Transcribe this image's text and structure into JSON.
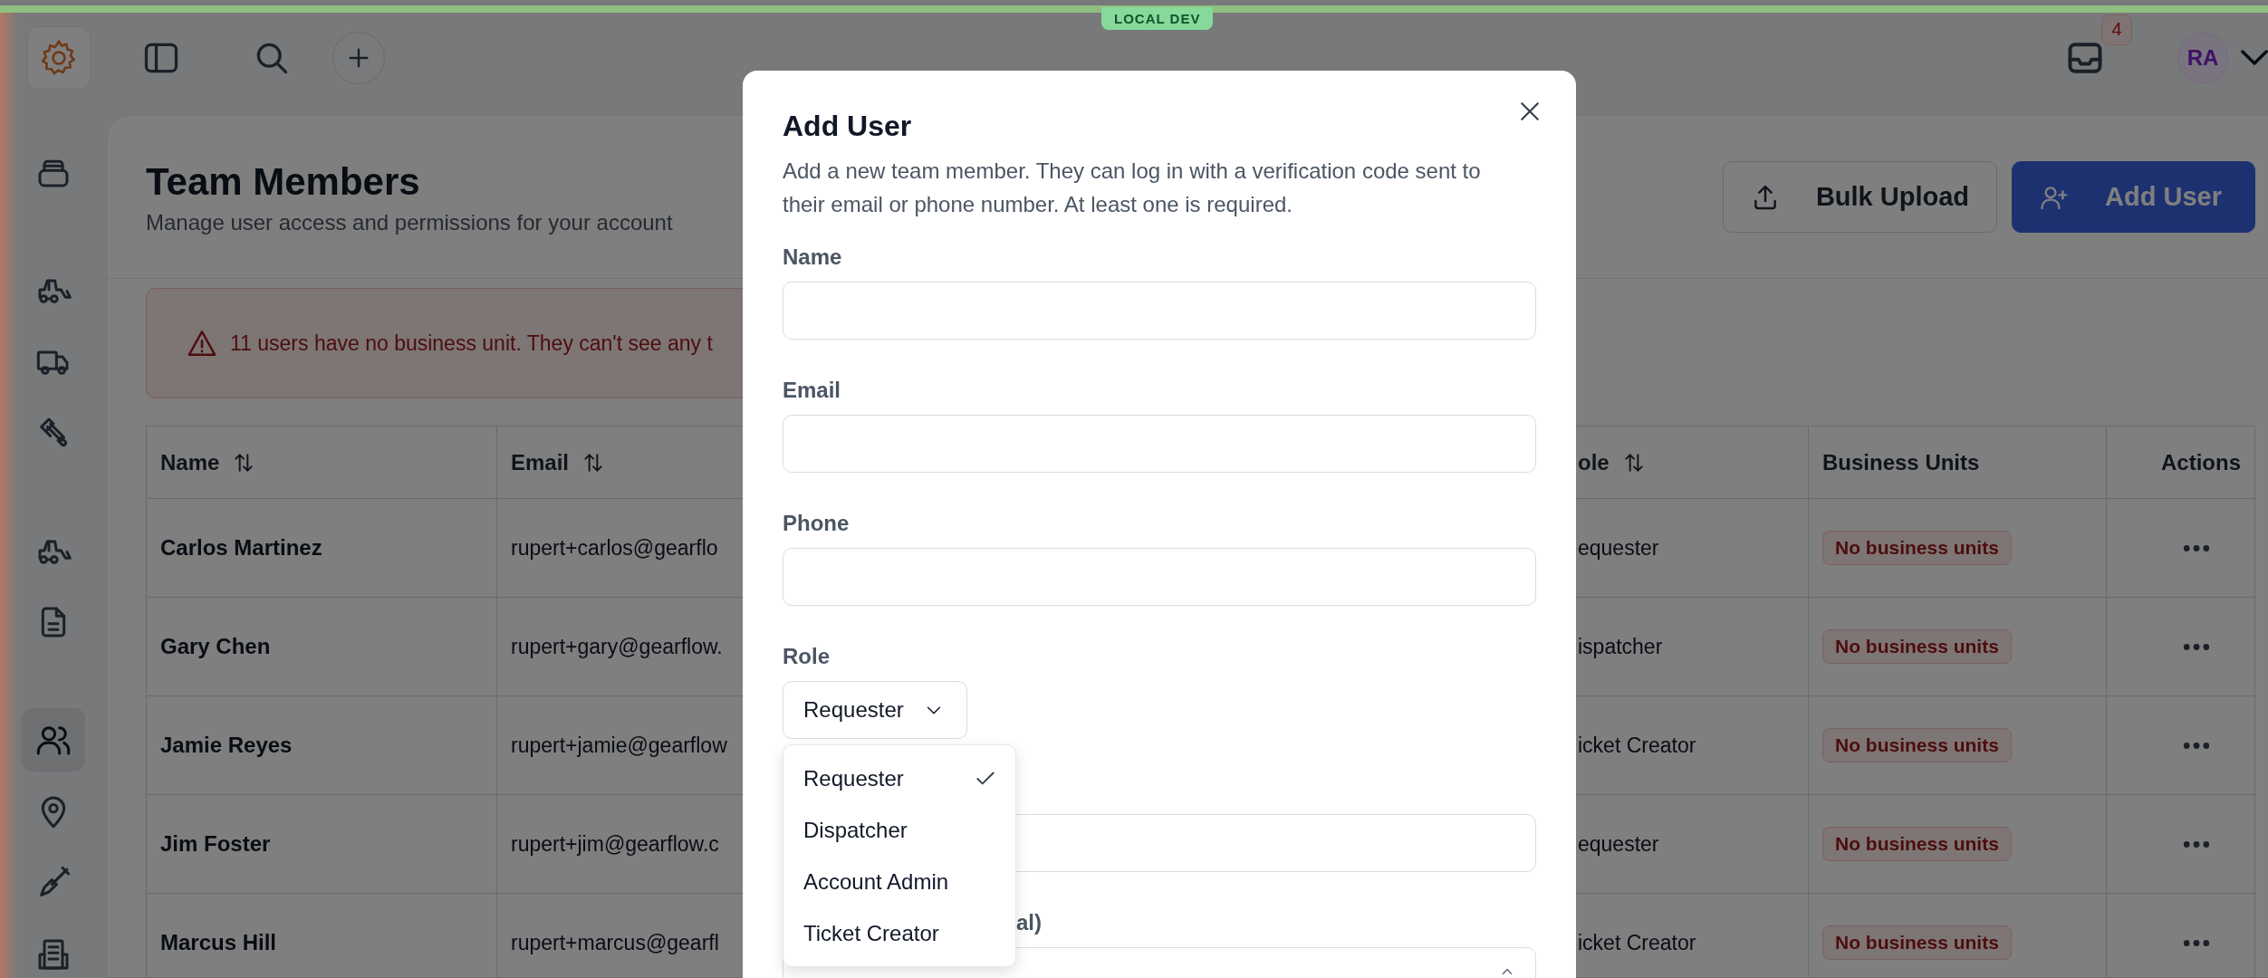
{
  "env_badge": "LOCAL DEV",
  "top_bar": {
    "notification_count": "4",
    "avatar_initials": "RA"
  },
  "sidebar": {
    "groups": [
      [
        {
          "kind": "bin",
          "selected": false
        }
      ],
      [
        {
          "kind": "skid_steer",
          "selected": false
        },
        {
          "kind": "truck",
          "selected": false
        },
        {
          "kind": "tools",
          "selected": false
        }
      ],
      [
        {
          "kind": "skid_steer",
          "selected": false
        },
        {
          "kind": "document",
          "selected": false
        }
      ],
      [
        {
          "kind": "users",
          "selected": true
        },
        {
          "kind": "pin",
          "selected": false
        },
        {
          "kind": "shovel",
          "selected": false
        },
        {
          "kind": "building",
          "selected": false
        }
      ]
    ]
  },
  "page": {
    "title": "Team Members",
    "subtitle": "Manage user access and permissions for your account",
    "buttons": [
      {
        "label": "Bulk Upload",
        "kind": "secondary"
      },
      {
        "label": "Add User",
        "kind": "primary"
      }
    ]
  },
  "alert": {
    "text": "11 users have no business unit. They can't see any t"
  },
  "table": {
    "columns": [
      {
        "label": "Name",
        "sortable": true
      },
      {
        "label": "Email",
        "sortable": true
      },
      {
        "label": "ole",
        "sortable": true
      },
      {
        "label": "Business Units",
        "sortable": false
      },
      {
        "label": "Actions",
        "sortable": false
      }
    ],
    "rows": [
      {
        "name": "Carlos Martinez",
        "email": "rupert+carlos@gearflo",
        "role": "equester",
        "business_units": "No business units"
      },
      {
        "name": "Gary Chen",
        "email": "rupert+gary@gearflow.",
        "role": "ispatcher",
        "business_units": "No business units"
      },
      {
        "name": "Jamie Reyes",
        "email": "rupert+jamie@gearflow",
        "role": "icket Creator",
        "business_units": "No business units"
      },
      {
        "name": "Jim Foster",
        "email": "rupert+jim@gearflow.c",
        "role": "equester",
        "business_units": "No business units"
      },
      {
        "name": "Marcus Hill",
        "email": "rupert+marcus@gearfl",
        "role": "icket Creator",
        "business_units": "No business units"
      }
    ]
  },
  "modal": {
    "title": "Add User",
    "description": "Add a new team member. They can log in with a verification code sent to their email or phone number. At least one is required.",
    "fields": [
      {
        "label": "Name",
        "kind": "text"
      },
      {
        "label": "Email",
        "kind": "text"
      },
      {
        "label": "Phone",
        "kind": "text"
      },
      {
        "label": "Role",
        "kind": "select",
        "value": "Requester",
        "expanded": true
      },
      {
        "kind": "text"
      },
      {
        "label": "al)",
        "kind": "multiselect"
      }
    ],
    "role_options": [
      {
        "label": "Requester",
        "selected": true
      },
      {
        "label": "Dispatcher",
        "selected": false
      },
      {
        "label": "Account Admin",
        "selected": false
      },
      {
        "label": "Ticket Creator",
        "selected": false
      }
    ]
  }
}
